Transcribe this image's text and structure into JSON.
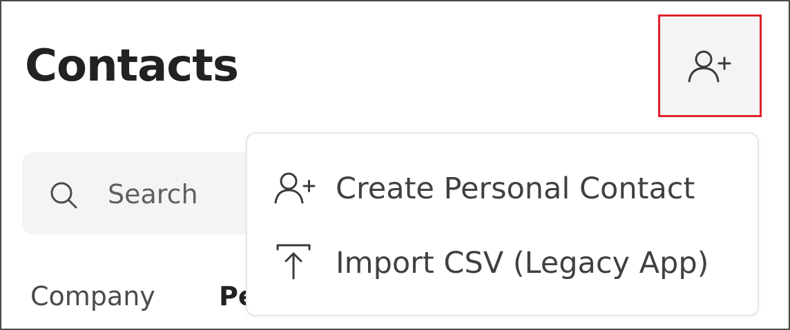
{
  "header": {
    "title": "Contacts",
    "add_button_icon": "add-person-icon"
  },
  "search": {
    "placeholder": "Search",
    "icon": "search-icon"
  },
  "tabs": [
    {
      "label": "Company",
      "active": false
    },
    {
      "label": "Pe",
      "active": true
    }
  ],
  "menu": {
    "items": [
      {
        "label": "Create Personal Contact",
        "icon": "add-person-icon"
      },
      {
        "label": "Import CSV (Legacy App)",
        "icon": "upload-icon"
      }
    ]
  },
  "colors": {
    "highlight_border": "#e0202a",
    "button_bg": "#f4f4f4",
    "text_primary": "#222222",
    "text_secondary": "#404040"
  }
}
